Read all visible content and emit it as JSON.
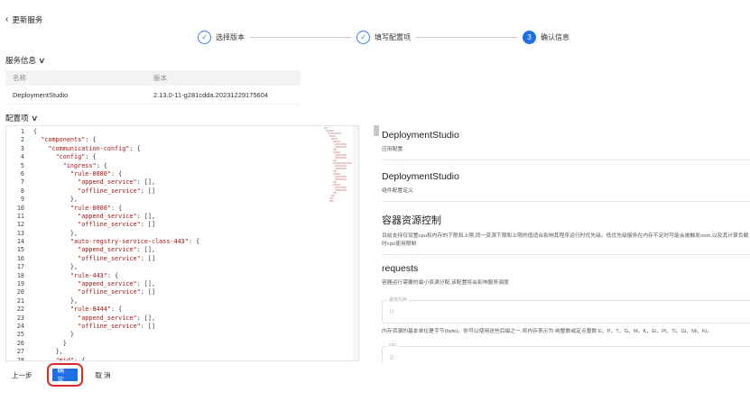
{
  "header": {
    "back_icon": "chevron-left-icon",
    "title": "更新服务"
  },
  "steps": [
    {
      "label": "选择版本",
      "state": "done",
      "mark": "✓"
    },
    {
      "label": "填写配置项",
      "state": "done",
      "mark": "✓"
    },
    {
      "label": "确认信息",
      "state": "active",
      "mark": "3"
    }
  ],
  "service_info": {
    "title": "服务信息",
    "columns": [
      "名称",
      "版本"
    ],
    "rows": [
      [
        "DeploymentStudio",
        "2.13.0-11-g281cdda.20231229175604"
      ]
    ]
  },
  "config": {
    "title": "配置项",
    "code_lines": [
      {
        "n": "1",
        "indent": 0,
        "text": "{"
      },
      {
        "n": "2",
        "indent": 1,
        "key": "\"components\"",
        "text": ": {"
      },
      {
        "n": "3",
        "indent": 2,
        "key": "\"communication-config\"",
        "text": ": {"
      },
      {
        "n": "4",
        "indent": 3,
        "key": "\"config\"",
        "text": ": {"
      },
      {
        "n": "5",
        "indent": 4,
        "key": "\"ingress\"",
        "text": ": {"
      },
      {
        "n": "6",
        "indent": 5,
        "key": "\"rule-8080\"",
        "text": ": {"
      },
      {
        "n": "7",
        "indent": 6,
        "key": "\"append_service\"",
        "text": ": [],"
      },
      {
        "n": "8",
        "indent": 6,
        "key": "\"offline_service\"",
        "text": ": []"
      },
      {
        "n": "9",
        "indent": 5,
        "text": "},"
      },
      {
        "n": "10",
        "indent": 5,
        "key": "\"rule-8000\"",
        "text": ": {"
      },
      {
        "n": "11",
        "indent": 6,
        "key": "\"append_service\"",
        "text": ": [],"
      },
      {
        "n": "12",
        "indent": 6,
        "key": "\"offline_service\"",
        "text": ": []"
      },
      {
        "n": "13",
        "indent": 5,
        "text": "},"
      },
      {
        "n": "14",
        "indent": 5,
        "key": "\"auto-regstry-service-class-443\"",
        "text": ": {"
      },
      {
        "n": "15",
        "indent": 6,
        "key": "\"append_service\"",
        "text": ": [],"
      },
      {
        "n": "16",
        "indent": 6,
        "key": "\"offline_service\"",
        "text": ": []"
      },
      {
        "n": "17",
        "indent": 5,
        "text": "},"
      },
      {
        "n": "18",
        "indent": 5,
        "key": "\"rule-443\"",
        "text": ": {"
      },
      {
        "n": "19",
        "indent": 6,
        "key": "\"append_service\"",
        "text": ": [],"
      },
      {
        "n": "20",
        "indent": 6,
        "key": "\"offline_service\"",
        "text": ": []"
      },
      {
        "n": "21",
        "indent": 5,
        "text": "},"
      },
      {
        "n": "22",
        "indent": 5,
        "key": "\"rule-8444\"",
        "text": ": {"
      },
      {
        "n": "23",
        "indent": 6,
        "key": "\"append_service\"",
        "text": ": [],"
      },
      {
        "n": "24",
        "indent": 6,
        "key": "\"offline_service\"",
        "text": ": []"
      },
      {
        "n": "25",
        "indent": 5,
        "text": "}"
      },
      {
        "n": "26",
        "indent": 4,
        "text": "}"
      },
      {
        "n": "27",
        "indent": 3,
        "text": "},"
      },
      {
        "n": "28",
        "indent": 3,
        "key": "\"mid\"",
        "text": ": {"
      }
    ]
  },
  "form": {
    "sections": [
      {
        "heading": "DeploymentStudio",
        "desc": "应用配置"
      },
      {
        "heading": "DeploymentStudio",
        "desc": "组件配置定义"
      },
      {
        "heading": "容器资源控制",
        "desc": "目前支持仅设置cpu和内存的下限和上限,同一资源下限和上限的值适合影响其程序运行时优先级。低优先级服务在内存不足时可能会被触发oom,以及其计算负载",
        "desc2": "时cpu使用限制"
      },
      {
        "heading": "requests",
        "desc": "容器运行需要的最小资源分配,该配置将会影响服务调度"
      }
    ],
    "memory_field": {
      "legend": "最低内存",
      "value": "0"
    },
    "memory_hint": "内存资源的基本单位是字节(byte)。你可以使用这些后缀之一,将内存表示为 纯整数或定点整数 E、P、T、G、M、K、Ei、Pi、Ti、Gi、Mi、Ki。",
    "cpu_field": {
      "legend": "cpu",
      "value": "0"
    }
  },
  "footer": {
    "prev_label": "上一步",
    "confirm_label": "确 定",
    "cancel_label": "取 消"
  },
  "colors": {
    "accent": "#1f6fe5",
    "highlight": "#d62b2b",
    "json_key": "#a31515"
  }
}
